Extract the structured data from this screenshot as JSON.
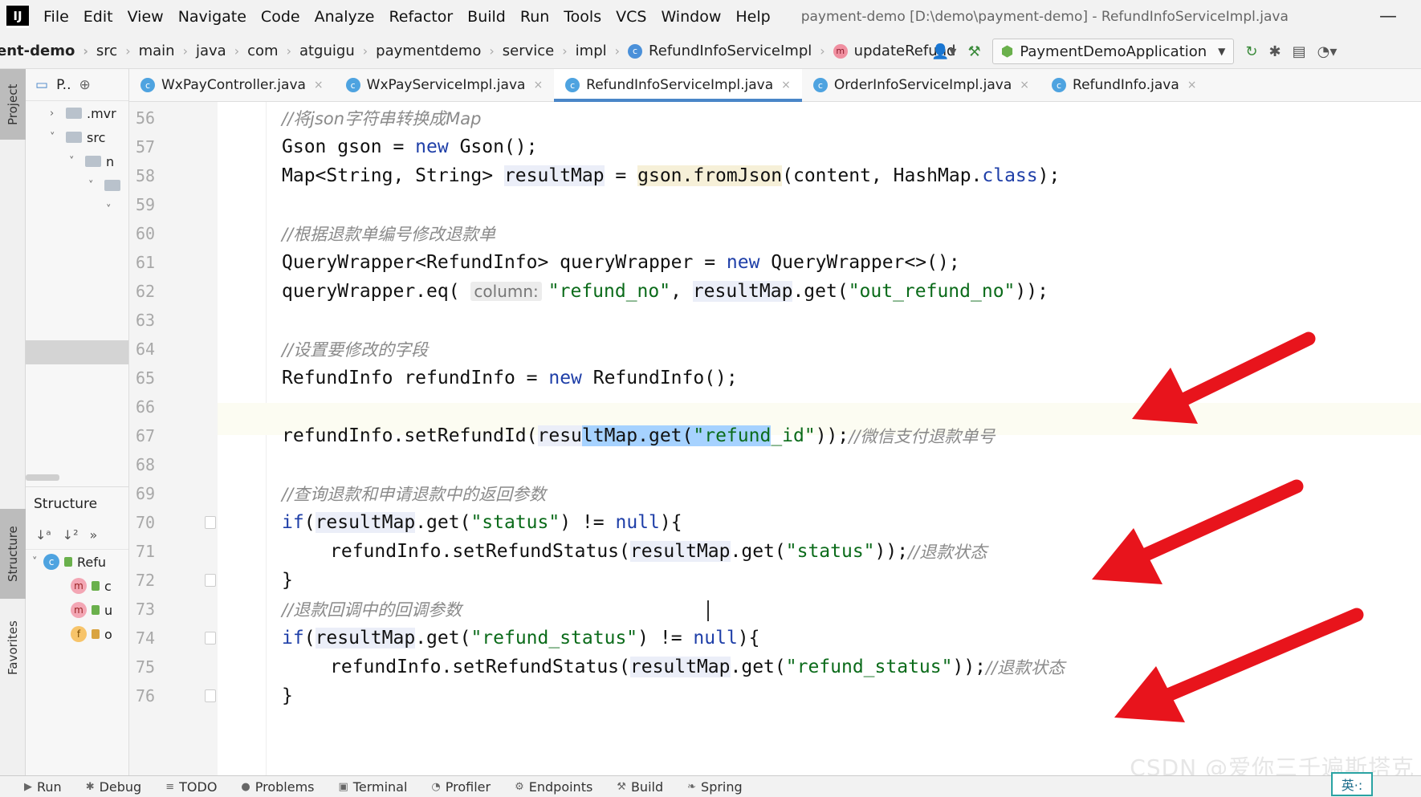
{
  "app": {
    "logo": "IJ",
    "window_title": "payment-demo [D:\\demo\\payment-demo] - RefundInfoServiceImpl.java",
    "minimize": "—"
  },
  "menu": [
    "File",
    "Edit",
    "View",
    "Navigate",
    "Code",
    "Analyze",
    "Refactor",
    "Build",
    "Run",
    "Tools",
    "VCS",
    "Window",
    "Help"
  ],
  "breadcrumb": [
    "ent-demo",
    "src",
    "main",
    "java",
    "com",
    "atguigu",
    "paymentdemo",
    "service",
    "impl",
    "RefundInfoServiceImpl",
    "updateRefund"
  ],
  "run_config": "PaymentDemoApplication",
  "left_stripe": {
    "project": "Project",
    "structure": "Structure",
    "favorites": "Favorites"
  },
  "project_panel": {
    "title": "P..",
    "tree": [
      {
        "indent": 1,
        "chev": "›",
        "label": ".mvr"
      },
      {
        "indent": 1,
        "chev": "˅",
        "label": "src"
      },
      {
        "indent": 2,
        "chev": "˅",
        "label": "n"
      },
      {
        "indent": 3,
        "chev": "˅",
        "label": ""
      },
      {
        "indent": 4,
        "chev": "˅",
        "label": ""
      }
    ]
  },
  "structure_panel": {
    "title": "Structure",
    "tools": [
      "↓ᵃ",
      "↓²",
      "»"
    ],
    "items": [
      {
        "badge": "c",
        "label": "Refu"
      },
      {
        "badge": "m",
        "label": "c"
      },
      {
        "badge": "m",
        "label": "u"
      },
      {
        "badge": "f",
        "label": "o"
      }
    ]
  },
  "tabs": [
    {
      "label": "WxPayController.java",
      "active": false
    },
    {
      "label": "WxPayServiceImpl.java",
      "active": false
    },
    {
      "label": "RefundInfoServiceImpl.java",
      "active": true
    },
    {
      "label": "OrderInfoServiceImpl.java",
      "active": false
    },
    {
      "label": "RefundInfo.java",
      "active": false
    }
  ],
  "line_numbers": [
    "56",
    "57",
    "58",
    "59",
    "60",
    "61",
    "62",
    "63",
    "64",
    "65",
    "66",
    "67",
    "68",
    "69",
    "70",
    "71",
    "72",
    "73",
    "74",
    "75",
    "76"
  ],
  "code": {
    "l56": "//将json字符串转换成Map",
    "l57_a": "Gson gson = ",
    "l57_kw": "new",
    "l57_b": " Gson();",
    "l58_a": "Map<String, String> ",
    "l58_var": "resultMap",
    "l58_b": " = ",
    "l58_hl": "gson.fromJson",
    "l58_c": "(content, HashMap.",
    "l58_kw": "class",
    "l58_d": ");",
    "l60": "//根据退款单编号修改退款单",
    "l61_a": "QueryWrapper<RefundInfo> queryWrapper = ",
    "l61_kw": "new",
    "l61_b": " QueryWrapper<>();",
    "l62_a": "queryWrapper.eq( ",
    "l62_hint": "column:",
    "l62_s1": "\"refund_no\"",
    "l62_b": ", ",
    "l62_var": "resultMap",
    "l62_c": ".get(",
    "l62_s2": "\"out_refund_no\"",
    "l62_d": "));",
    "l64": "//设置要修改的字段",
    "l65_a": "RefundInfo refundInfo = ",
    "l65_kw": "new",
    "l65_b": " RefundInfo();",
    "l67_a": "refundInfo.setRefundId(",
    "l67_v1": "resu",
    "l67_sel1": "ltMap.get(",
    "l67_sel2": "\"refund",
    "l67_s": "_id\"",
    "l67_b": "));",
    "l67_cm": "//微信支付退款单号",
    "l69": "//查询退款和申请退款中的返回参数",
    "l70_kw": "if",
    "l70_a": "(",
    "l70_var": "resultMap",
    "l70_b": ".get(",
    "l70_s": "\"status\"",
    "l70_c": ") != ",
    "l70_kw2": "null",
    "l70_d": "){",
    "l71_a": "refundInfo.setRefundStatus(",
    "l71_var": "resultMap",
    "l71_b": ".get(",
    "l71_s": "\"status\"",
    "l71_c": "));",
    "l71_cm": "//退款状态",
    "l72": "}",
    "l73": "//退款回调中的回调参数",
    "l74_kw": "if",
    "l74_a": "(",
    "l74_var": "resultMap",
    "l74_b": ".get(",
    "l74_s": "\"refund_status\"",
    "l74_c": ") != ",
    "l74_kw2": "null",
    "l74_d": "){",
    "l75_a": "refundInfo.setRefundStatus(",
    "l75_var": "resultMap",
    "l75_b": ".get(",
    "l75_s": "\"refund_status\"",
    "l75_c": "));",
    "l75_cm": "//退款状态",
    "l76": "}"
  },
  "annotation_color": "#e8141c",
  "bottom_tools": [
    {
      "icon": "▶",
      "label": "Run"
    },
    {
      "icon": "✱",
      "label": "Debug"
    },
    {
      "icon": "≡",
      "label": "TODO"
    },
    {
      "icon": "●",
      "label": "Problems"
    },
    {
      "icon": "▣",
      "label": "Terminal"
    },
    {
      "icon": "◔",
      "label": "Profiler"
    },
    {
      "icon": "⚙",
      "label": "Endpoints"
    },
    {
      "icon": "⚒",
      "label": "Build"
    },
    {
      "icon": "❧",
      "label": "Spring"
    }
  ],
  "watermark": "CSDN @爱你三千遍斯塔克",
  "ime": "英·:"
}
